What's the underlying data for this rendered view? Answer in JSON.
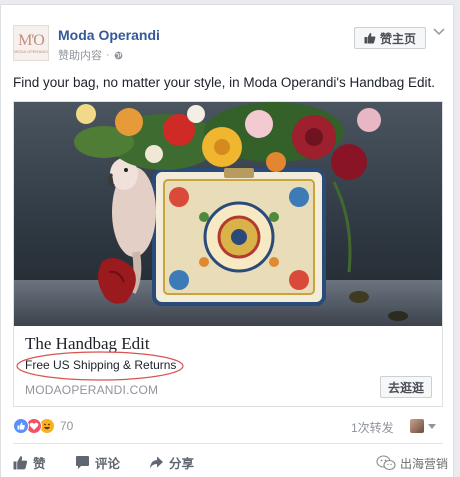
{
  "post": {
    "page_name": "Moda Operandi",
    "avatar_text": "M'O",
    "avatar_subtext": "MODA OPERANDI",
    "sponsored_label": "赞助内容",
    "like_page_label": "赞主页",
    "text": "Find your bag, no matter your style, in Moda Operandi's Handbag Edit."
  },
  "link": {
    "title": "The Handbag Edit",
    "description": "Free US Shipping & Returns",
    "domain": "MODAOPERANDI.COM",
    "cta_label": "去逛逛"
  },
  "engagement": {
    "reaction_count": "70",
    "shares": "1次转发"
  },
  "actions": {
    "like": "赞",
    "comment": "评论",
    "share": "分享"
  },
  "watermark": {
    "text": "出海营销"
  },
  "colors": {
    "brand_blue": "#365899",
    "like_blue": "#5890ff",
    "love_red": "#f25268",
    "haha_yellow": "#f7b125",
    "annotation_red": "#d9534f"
  },
  "icons": [
    "globe-icon",
    "thumbs-up-icon",
    "chevron-down-icon",
    "like-reaction-icon",
    "love-reaction-icon",
    "haha-reaction-icon",
    "comment-icon",
    "share-icon",
    "wechat-icon"
  ]
}
